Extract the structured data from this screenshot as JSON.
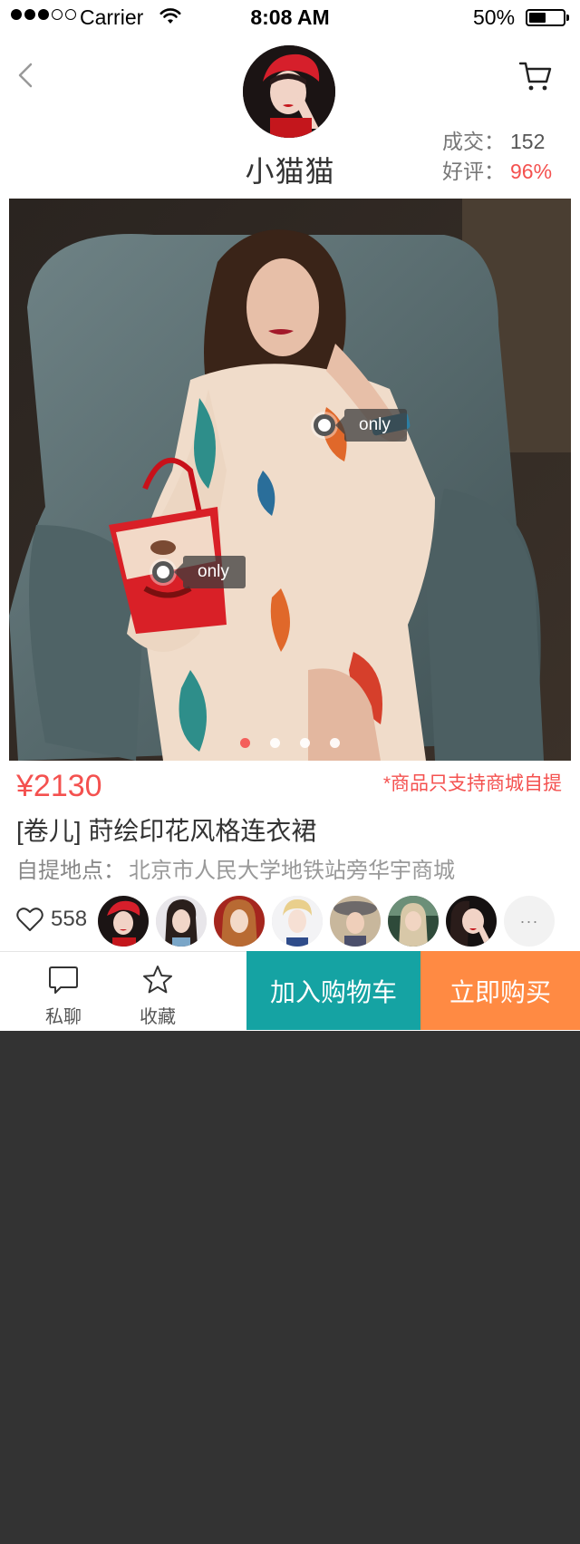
{
  "status_bar": {
    "carrier": "Carrier",
    "time": "8:08 AM",
    "battery": "50%"
  },
  "header": {
    "shop_name": "小猫猫",
    "stats": {
      "deals_label": "成交：",
      "deals_value": "152",
      "rating_label": "好评：",
      "rating_value": "96%"
    }
  },
  "hero": {
    "tags": [
      {
        "label": "only"
      },
      {
        "label": "only"
      }
    ],
    "carousel_count": 4,
    "carousel_active_index": 0
  },
  "product": {
    "price": "¥2130",
    "notice": "*商品只支持商城自提",
    "title": "[卷儿]  莳绘印花风格连衣裙",
    "pickup_label": "自提地点：",
    "pickup_address": "北京市人民大学地铁站旁华宇商城"
  },
  "social": {
    "like_count": "558",
    "more_label": "···"
  },
  "actions": {
    "chat_label": "私聊",
    "favorite_label": "收藏",
    "add_to_cart_label": "加入购物车",
    "buy_now_label": "立即购买"
  },
  "colors": {
    "accent_red": "#f4514f",
    "cart_teal": "#15a3a3",
    "buy_orange": "#ff8a43",
    "backdrop": "#333333"
  },
  "icons": [
    "signal-dots-icon",
    "wifi-icon",
    "battery-icon",
    "back-chevron-icon",
    "cart-icon",
    "heart-icon",
    "chat-bubble-icon",
    "star-icon"
  ]
}
